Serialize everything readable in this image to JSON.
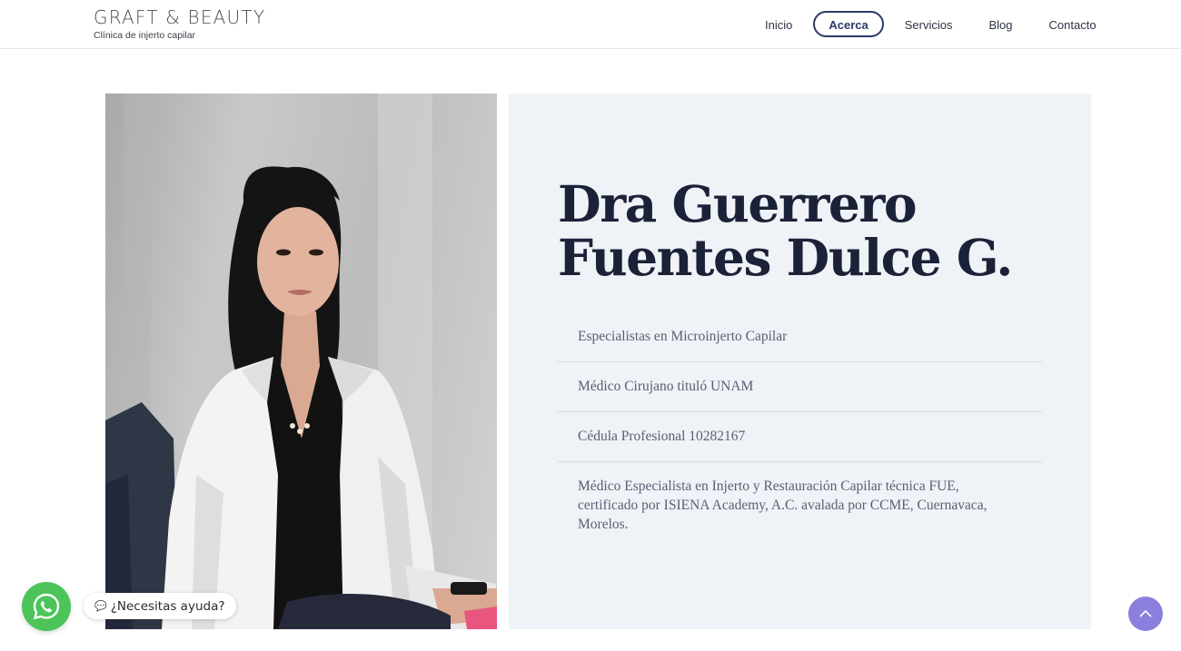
{
  "header": {
    "logo_title": "GRAFT & BEAUTY",
    "logo_subtitle": "Clínica de injerto capilar",
    "nav": [
      {
        "label": "Inicio"
      },
      {
        "label": "Acerca"
      },
      {
        "label": "Servicios"
      },
      {
        "label": "Blog"
      },
      {
        "label": "Contacto"
      }
    ],
    "active_nav": "Acerca"
  },
  "profile": {
    "name_line1": "Dra Guerrero",
    "name_line2": "Fuentes Dulce G.",
    "credentials": [
      "Especialistas en Microinjerto Capilar",
      "Médico Cirujano tituló UNAM",
      "Cédula Profesional 10282167",
      "Médico Especialista en Injerto y Restauración Capilar técnica FUE, certificado por ISIENA Academy, A.C. avalada por CCME, Cuernavaca, Morelos."
    ]
  },
  "widgets": {
    "whatsapp_label": "¿Necesitas ayuda?",
    "whatsapp_icon": "whatsapp-icon",
    "scroll_top_icon": "chevron-up-icon"
  },
  "colors": {
    "accent_nav": "#2b3a67",
    "panel_bg": "#eff2f6",
    "whatsapp_green": "#4cc459",
    "scroll_top": "#8a7fdc"
  }
}
